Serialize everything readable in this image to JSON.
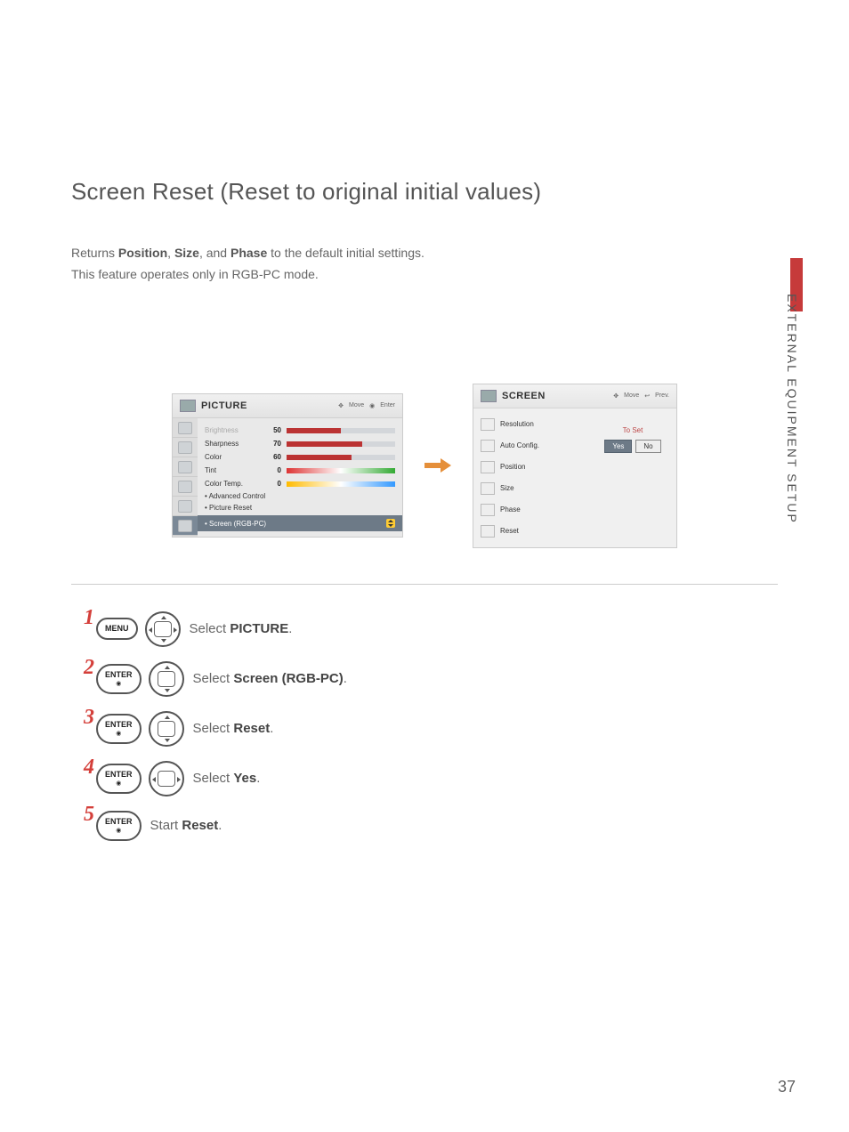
{
  "page": {
    "title": "Screen Reset (Reset to original initial values)",
    "intro_prefix": "Returns ",
    "intro_b1": "Position",
    "intro_sep1": ", ",
    "intro_b2": "Size",
    "intro_sep2": ", and ",
    "intro_b3": "Phase",
    "intro_suffix": " to the default initial settings.",
    "intro_line2": "This feature operates only in RGB-PC mode.",
    "section_label": "EXTERNAL EQUIPMENT SETUP",
    "number": "37"
  },
  "osd_picture": {
    "title": "PICTURE",
    "hint_move": "Move",
    "hint_enter": "Enter",
    "items": [
      {
        "label": "Brightness",
        "value": "50",
        "fill": 50,
        "type": "bar",
        "dim": true
      },
      {
        "label": "Sharpness",
        "value": "70",
        "fill": 70,
        "type": "bar"
      },
      {
        "label": "Color",
        "value": "60",
        "fill": 60,
        "type": "bar"
      },
      {
        "label": "Tint",
        "value": "0",
        "type": "tint"
      },
      {
        "label": "Color Temp.",
        "value": "0",
        "type": "temp"
      }
    ],
    "adv": "Advanced Control",
    "preset": "Picture Reset",
    "selected": "Screen (RGB-PC)"
  },
  "osd_screen": {
    "title": "SCREEN",
    "hint_move": "Move",
    "hint_prev": "Prev.",
    "list": [
      "Resolution",
      "Auto Config.",
      "Position",
      "Size",
      "Phase",
      "Reset"
    ],
    "toset": "To Set",
    "yes": "Yes",
    "no": "No"
  },
  "steps": {
    "s1": {
      "n": "1",
      "btn": "MENU",
      "text_pre": "Select ",
      "text_b": "PICTURE",
      "text_post": "."
    },
    "s2": {
      "n": "2",
      "btn": "ENTER",
      "text_pre": "Select ",
      "text_b": "Screen (RGB-PC)",
      "text_post": "."
    },
    "s3": {
      "n": "3",
      "btn": "ENTER",
      "text_pre": "Select ",
      "text_b": "Reset",
      "text_post": "."
    },
    "s4": {
      "n": "4",
      "btn": "ENTER",
      "text_pre": "Select ",
      "text_b": "Yes",
      "text_post": "."
    },
    "s5": {
      "n": "5",
      "btn": "ENTER",
      "text_pre": "Start ",
      "text_b": "Reset",
      "text_post": "."
    }
  }
}
